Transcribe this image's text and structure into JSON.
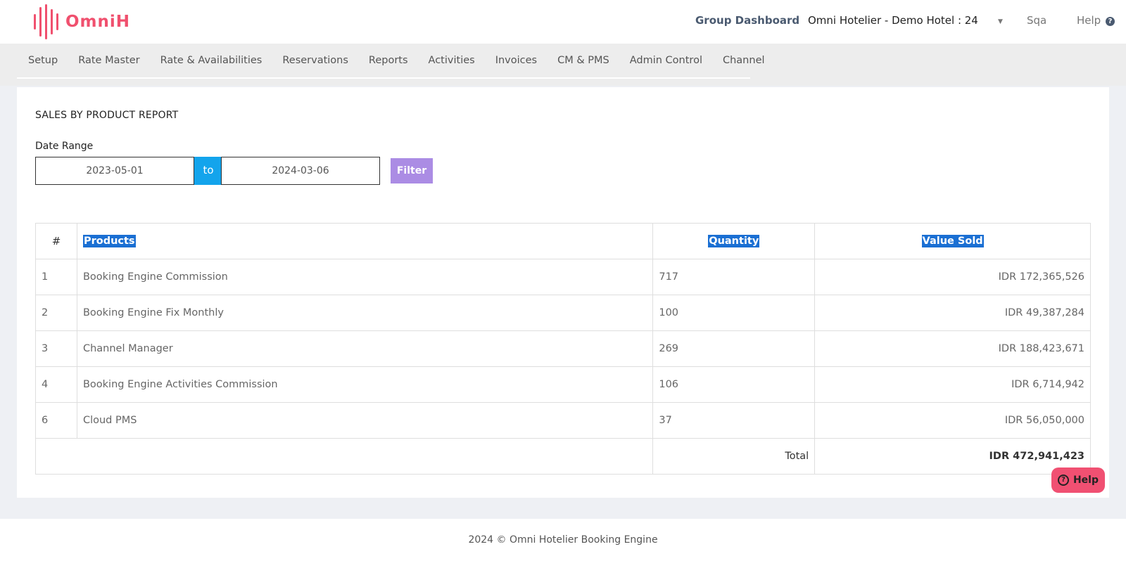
{
  "header": {
    "logo_text": "OmniH",
    "group_dashboard": "Group Dashboard",
    "hotel_selected": "Omni Hotelier - Demo Hotel : 24",
    "user": "Sqa",
    "help": "Help",
    "help_icon": "question-circle-icon"
  },
  "nav": {
    "items": [
      "Setup",
      "Rate Master",
      "Rate & Availabilities",
      "Reservations",
      "Reports",
      "Activities",
      "Invoices",
      "CM & PMS",
      "Admin Control",
      "Channel"
    ]
  },
  "report": {
    "title": "SALES BY PRODUCT REPORT",
    "date_range_label": "Date Range",
    "date_from": "2023-05-01",
    "to_label": "to",
    "date_to": "2024-03-06",
    "filter_label": "Filter",
    "columns": [
      "#",
      "Products",
      "Quantity",
      "Value Sold"
    ],
    "rows": [
      {
        "no": "1",
        "product": "Booking Engine Commission",
        "quantity": "717",
        "value": "IDR 172,365,526"
      },
      {
        "no": "2",
        "product": "Booking Engine Fix Monthly",
        "quantity": "100",
        "value": "IDR 49,387,284"
      },
      {
        "no": "3",
        "product": "Channel Manager",
        "quantity": "269",
        "value": "IDR 188,423,671"
      },
      {
        "no": "4",
        "product": "Booking Engine Activities Commission",
        "quantity": "106",
        "value": "IDR 6,714,942"
      },
      {
        "no": "6",
        "product": "Cloud PMS",
        "quantity": "37",
        "value": "IDR 56,050,000"
      }
    ],
    "total_label": "Total",
    "total_value": "IDR 472,941,423"
  },
  "help_button": {
    "label": "Help",
    "icon": "question-circle-icon"
  },
  "footer": {
    "text": "2024 © Omni Hotelier Booking Engine"
  },
  "colors": {
    "brand": "#f0506e",
    "accent": "#13a4ec",
    "filter": "#ab8ce4",
    "help": "#f05072"
  }
}
